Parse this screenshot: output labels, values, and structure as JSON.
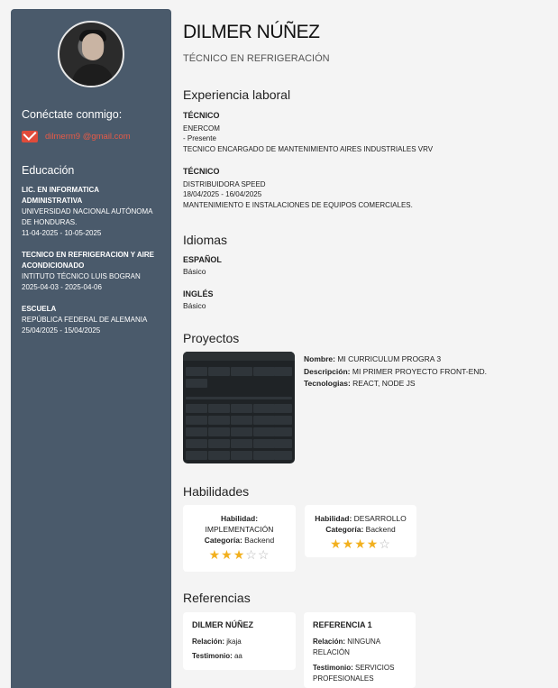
{
  "profile": {
    "name": "DILMER NÚÑEZ",
    "title": "TÉCNICO EN REFRIGERACIÓN"
  },
  "sidebar": {
    "connect_heading": "Conéctate conmigo:",
    "email": "dilmerm9 @gmail.com",
    "education_heading": "Educación",
    "education": [
      {
        "degree1": "LIC. EN INFORMATICA",
        "degree2": "ADMINISTRATIVA",
        "school1": "UNIVERSIDAD NACIONAL AUTÓNOMA",
        "school2": "DE HONDURAS.",
        "dates": "11-04-2025 - 10-05-2025"
      },
      {
        "degree1": "TECNICO EN REFRIGERACION Y AIRE",
        "degree2": "ACONDICIONADO",
        "school1": "INTITUTO TÉCNICO LUIS BOGRAN",
        "school2": "",
        "dates": "2025-04-03 - 2025-04-06"
      },
      {
        "degree1": "ESCUELA",
        "degree2": "",
        "school1": "REPÚBLICA FEDERAL DE ALEMANIA",
        "school2": "",
        "dates": "25/04/2025 - 15/04/2025"
      }
    ]
  },
  "experience": {
    "heading": "Experiencia laboral",
    "jobs": [
      {
        "title": "TÉCNICO",
        "company": "ENERCOM",
        "dates": "- Presente",
        "desc": "TECNICO ENCARGADO DE MANTENIMIENTO AIRES INDUSTRIALES VRV"
      },
      {
        "title": "TÉCNICO",
        "company": "DISTRIBUIDORA SPEED",
        "dates": "18/04/2025 - 16/04/2025",
        "desc": "MANTENIMIENTO E INSTALACIONES DE EQUIPOS COMERCIALES."
      }
    ]
  },
  "languages": {
    "heading": "Idiomas",
    "items": [
      {
        "name": "ESPAÑOL",
        "level": "Básico"
      },
      {
        "name": "INGLÉS",
        "level": "Básico"
      }
    ]
  },
  "projects": {
    "heading": "Proyectos",
    "name_label": "Nombre:",
    "name": "MI CURRICULUM PROGRA 3",
    "desc_label": "Descripción:",
    "desc": "MI PRIMER PROYECTO FRONT-END.",
    "tech_label": "Tecnologias:",
    "tech": "REACT, NODE JS"
  },
  "skills": {
    "heading": "Habilidades",
    "skill_label": "Habilidad:",
    "category_label": "Categoría:",
    "items": [
      {
        "name": "IMPLEMENTACIÓN",
        "category": "Backend",
        "rating": 3,
        "max": 5
      },
      {
        "name": "DESARROLLO",
        "category": "Backend",
        "rating": 4,
        "max": 5
      }
    ]
  },
  "references": {
    "heading": "Referencias",
    "relation_label": "Relación:",
    "testimony_label": "Testimonio:",
    "items": [
      {
        "name": "DILMER NÚÑEZ",
        "relation": "jkaja",
        "testimony": "aa"
      },
      {
        "name": "REFERENCIA 1",
        "relation": "NINGUNA RELACIÓN",
        "testimony": "SERVICIOS PROFESIONALES"
      }
    ]
  }
}
